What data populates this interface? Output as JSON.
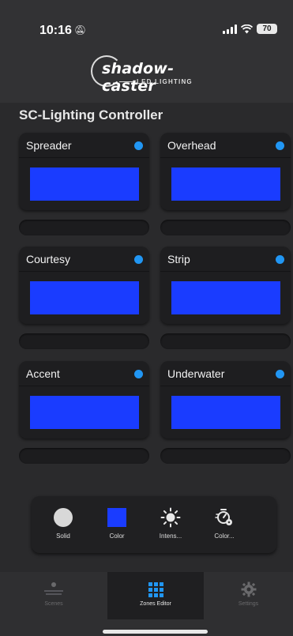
{
  "status_bar": {
    "time": "10:16",
    "battery": "70"
  },
  "header": {
    "logo_main": "shadow-caster",
    "logo_sub": "LED LIGHTING"
  },
  "page": {
    "title": "SC-Lighting Controller"
  },
  "zones": [
    {
      "name": "Spreader",
      "color": "#1a3cff",
      "on": true
    },
    {
      "name": "Overhead",
      "color": "#1a3cff",
      "on": true
    },
    {
      "name": "Courtesy",
      "color": "#1a3cff",
      "on": true
    },
    {
      "name": "Strip",
      "color": "#1a3cff",
      "on": true
    },
    {
      "name": "Accent",
      "color": "#1a3cff",
      "on": true
    },
    {
      "name": "Underwater",
      "color": "#1a3cff",
      "on": true
    }
  ],
  "modes": [
    {
      "label": "Solid",
      "icon": "solid-circle-icon"
    },
    {
      "label": "Color",
      "icon": "color-swatch-icon"
    },
    {
      "label": "Intens...",
      "icon": "sun-icon"
    },
    {
      "label": "Color...",
      "icon": "color-cycle-icon"
    }
  ],
  "tabs": [
    {
      "label": "Scenes",
      "icon": "scenes-icon",
      "active": false
    },
    {
      "label": "Zones Editor",
      "icon": "grid-icon",
      "active": true
    },
    {
      "label": "Settings",
      "icon": "gear-icon",
      "active": false
    }
  ],
  "colors": {
    "accent": "#2196f3",
    "zone_color": "#1a3cff",
    "background": "#2a2a2c"
  }
}
